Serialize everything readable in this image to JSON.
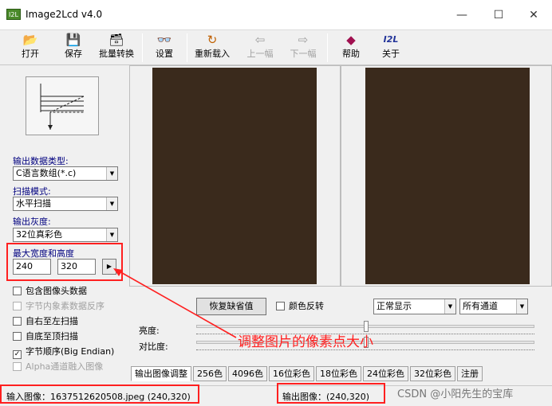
{
  "window": {
    "title": "Image2Lcd v4.0",
    "app_icon_text": "I2L",
    "min_symbol": "—",
    "max_symbol": "☐",
    "close_symbol": "✕"
  },
  "toolbar": {
    "open": "打开",
    "save": "保存",
    "batch": "批量转换",
    "settings": "设置",
    "reload": "重新载入",
    "prev": "上一幅",
    "next": "下一幅",
    "help": "帮助",
    "about": "关于",
    "about_icon_text": "I2L"
  },
  "left": {
    "output_type_label": "输出数据类型:",
    "output_type_value": "C语言数组(*.c)",
    "scan_mode_label": "扫描模式:",
    "scan_mode_value": "水平扫描",
    "gray_label": "输出灰度:",
    "gray_value": "32位真彩色",
    "size_label": "最大宽度和高度",
    "width_value": "240",
    "height_value": "320",
    "options": [
      {
        "label": "包含图像头数据",
        "checked": false,
        "enabled": true
      },
      {
        "label": "字节内象素数据反序",
        "checked": false,
        "enabled": false
      },
      {
        "label": "自右至左扫描",
        "checked": false,
        "enabled": true
      },
      {
        "label": "自底至顶扫描",
        "checked": false,
        "enabled": true
      },
      {
        "label": "字节顺序(Big Endian)",
        "checked": true,
        "enabled": true
      },
      {
        "label": "Alpha通道融入图像",
        "checked": false,
        "enabled": false
      }
    ]
  },
  "bottom": {
    "restore_default": "恢复缺省值",
    "invert_color": "颜色反转",
    "display_mode": "正常显示",
    "channel": "所有通道",
    "brightness_label": "亮度:",
    "contrast_label": "对比度:",
    "brightness_level": 0.5,
    "contrast_level": 0.5,
    "tabs": [
      "输出图像调整",
      "256色",
      "4096色",
      "16位彩色",
      "18位彩色",
      "24位彩色",
      "32位彩色",
      "注册"
    ]
  },
  "status": {
    "input_image": "输入图像：1637512620508.jpeg (240,320)",
    "output_image": "输出图像：(240,320)"
  },
  "annotation": "调整图片的像素点大小",
  "watermark": "CSDN @小阳先生的宝库",
  "colors": {
    "accent_red": "#ff2020",
    "label_blue": "#00007f"
  }
}
